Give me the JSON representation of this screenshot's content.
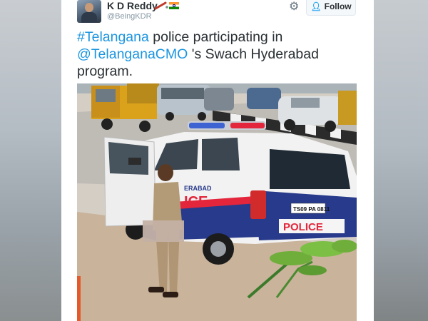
{
  "tweet": {
    "author_name": "K D Reddy",
    "author_handle": "@BeingKDR",
    "follow_label": "Follow",
    "text": {
      "hashtag": "#Telangana",
      "part1": " police participating in",
      "mention": "@TelanganaCMO",
      "part2": " 's Swach Hyderabad",
      "part3": "program."
    }
  },
  "photo": {
    "car_lettering_left": "ERABAD",
    "car_lettering_door": "ICE",
    "rear_label": "POLICE",
    "plate": "TS09 PA 0811"
  },
  "icons": [
    "avatar",
    "cricket-bat-icon",
    "india-flag-icon",
    "gear-icon",
    "add-user-icon"
  ],
  "colors": {
    "link": "#1b95e0",
    "text": "#292f33",
    "handle": "#8899a6",
    "police_red": "#e3263b",
    "police_blue": "#283a8c"
  }
}
